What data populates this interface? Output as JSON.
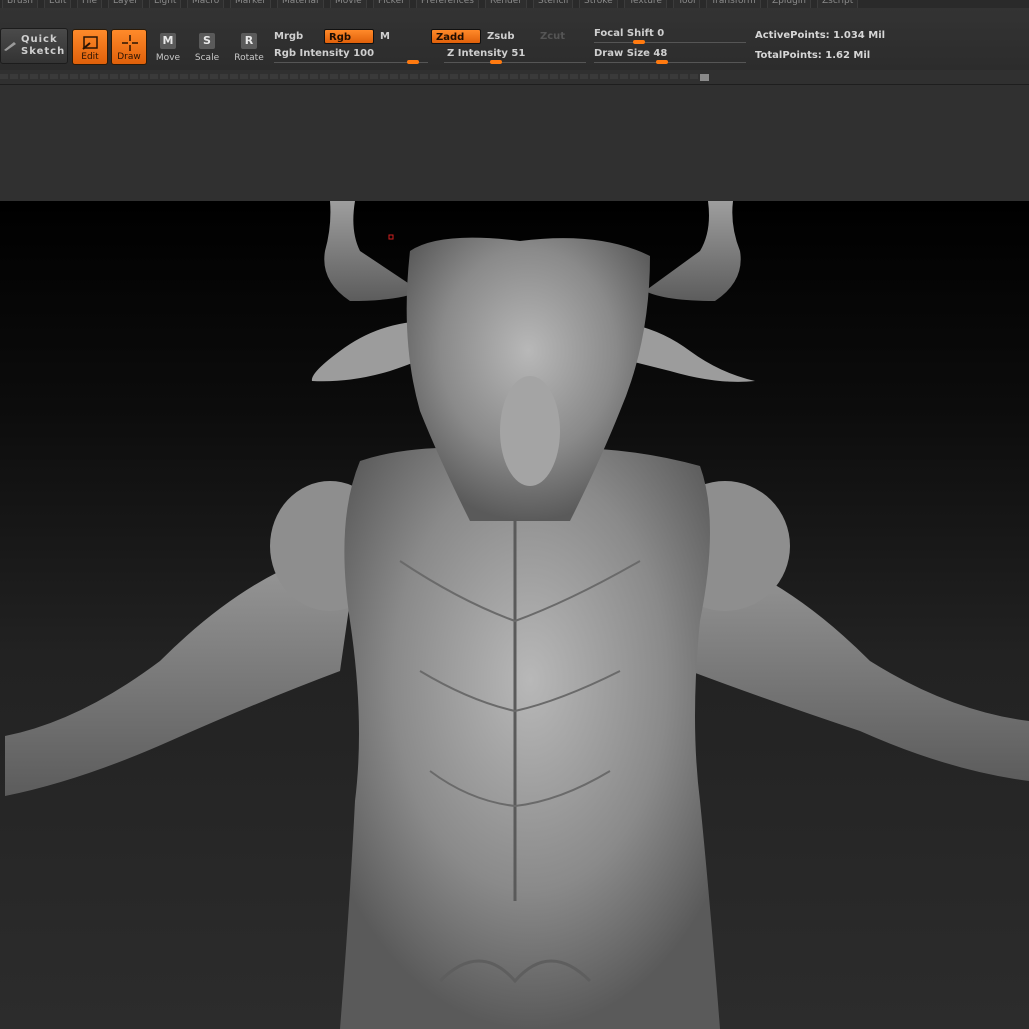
{
  "menu": [
    "Brush",
    "Edit",
    "File",
    "Layer",
    "Light",
    "Macro",
    "Marker",
    "Material",
    "Movie",
    "Picker",
    "Preferences",
    "Render",
    "Stencil",
    "Stroke",
    "Texture",
    "Tool",
    "Transform",
    "Zplugin",
    "Zscript"
  ],
  "toolbar": {
    "quick_sketch_line1": "Quick",
    "quick_sketch_line2": "Sketch",
    "edit_label": "Edit",
    "draw_label": "Draw",
    "move_label": "Move",
    "move_glyph": "M",
    "scale_label": "Scale",
    "scale_glyph": "S",
    "rotate_label": "Rotate",
    "rotate_glyph": "R"
  },
  "modes": {
    "mrgb": "Mrgb",
    "rgb": "Rgb",
    "m": "M",
    "zadd": "Zadd",
    "zsub": "Zsub",
    "zcut": "Zcut"
  },
  "sliders": {
    "rgb_intensity_label": "Rgb Intensity",
    "rgb_intensity": 100,
    "z_intensity_label": "Z Intensity",
    "z_intensity": 51,
    "focal_shift_label": "Focal Shift",
    "focal_shift": 0,
    "draw_size_label": "Draw Size",
    "draw_size": 48
  },
  "stats": {
    "active_points": "ActivePoints: 1.034 Mil",
    "total_points": "TotalPoints: 1.62 Mil"
  },
  "colors": {
    "accent": "#ff7a10",
    "panel": "#303030",
    "canvas_top": "#000000",
    "canvas_bottom": "#2c2c2c",
    "model": "#8c8c8c"
  }
}
